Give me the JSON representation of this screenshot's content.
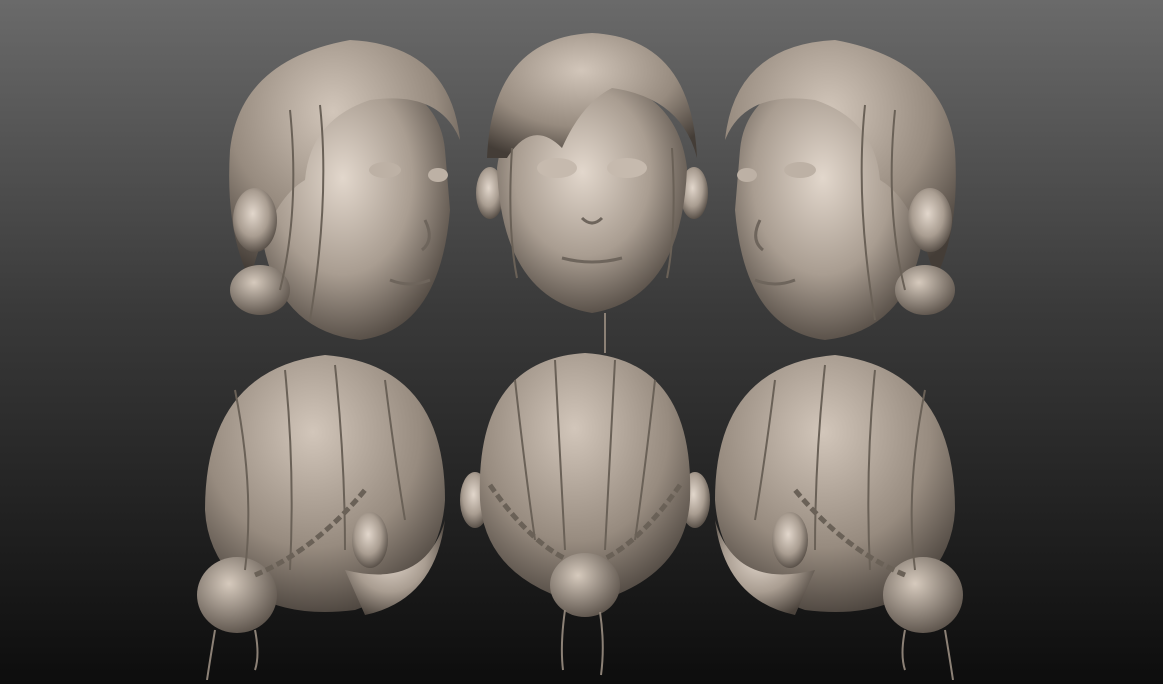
{
  "scene": {
    "background_top": "#6a6a6a",
    "background_bottom": "#0d0d0d",
    "clay_light": "#d8ccc0",
    "clay_mid": "#a89c90",
    "clay_dark": "#4e463f"
  },
  "views": [
    {
      "name": "front-left-three-quarter"
    },
    {
      "name": "front"
    },
    {
      "name": "front-right-three-quarter"
    },
    {
      "name": "back-left-three-quarter"
    },
    {
      "name": "back"
    },
    {
      "name": "back-right-three-quarter"
    }
  ]
}
